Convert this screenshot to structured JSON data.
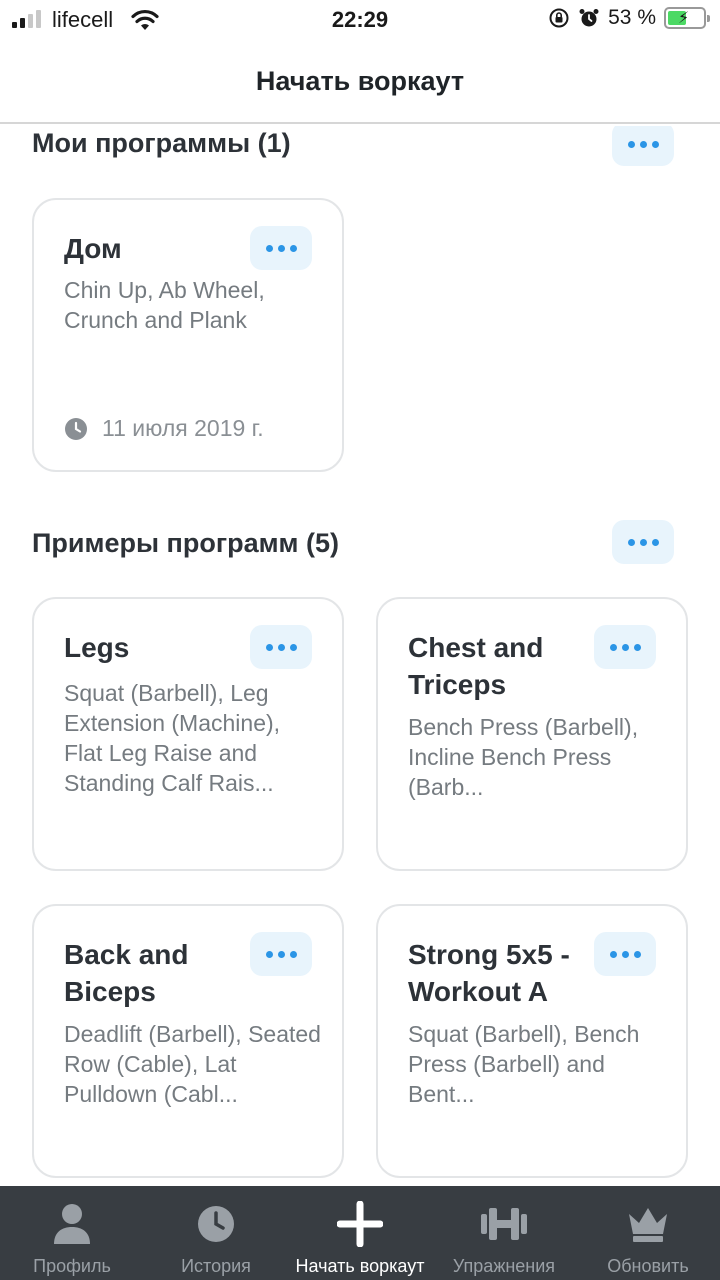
{
  "status_bar": {
    "carrier": "lifecell",
    "time": "22:29",
    "battery": "53 %",
    "battery_level": 0.53
  },
  "header": {
    "title": "Начать воркаут"
  },
  "my_programs": {
    "title": "Мои программы (1)",
    "cards": [
      {
        "title": "Дом",
        "description": "Chin Up, Ab Wheel, Crunch and Plank",
        "date": "11 июля 2019 г."
      }
    ]
  },
  "sample_programs": {
    "title": "Примеры программ (5)",
    "cards": [
      {
        "title": "Legs",
        "description": "Squat (Barbell), Leg Extension (Machine), Flat Leg Raise and Standing Calf Rais..."
      },
      {
        "title": "Chest and Triceps",
        "description": "Bench Press (Barbell), Incline Bench Press (Barb..."
      },
      {
        "title": "Back and Biceps",
        "description": "Deadlift (Barbell), Seated Row (Cable), Lat Pulldown (Cabl..."
      },
      {
        "title": "Strong 5x5 - Workout A",
        "description": "Squat (Barbell), Bench Press (Barbell) and Bent..."
      }
    ]
  },
  "tabbar": {
    "items": [
      {
        "label": "Профиль",
        "icon": "person-icon"
      },
      {
        "label": "История",
        "icon": "clock-icon"
      },
      {
        "label": "Начать воркаут",
        "icon": "plus-icon",
        "active": true
      },
      {
        "label": "Упражнения",
        "icon": "dumbbell-icon"
      },
      {
        "label": "Обновить",
        "icon": "crown-icon"
      }
    ]
  },
  "colors": {
    "accent": "#2b95e6",
    "accent_bg": "#e8f4fc",
    "tabbar_bg": "#383d42"
  }
}
